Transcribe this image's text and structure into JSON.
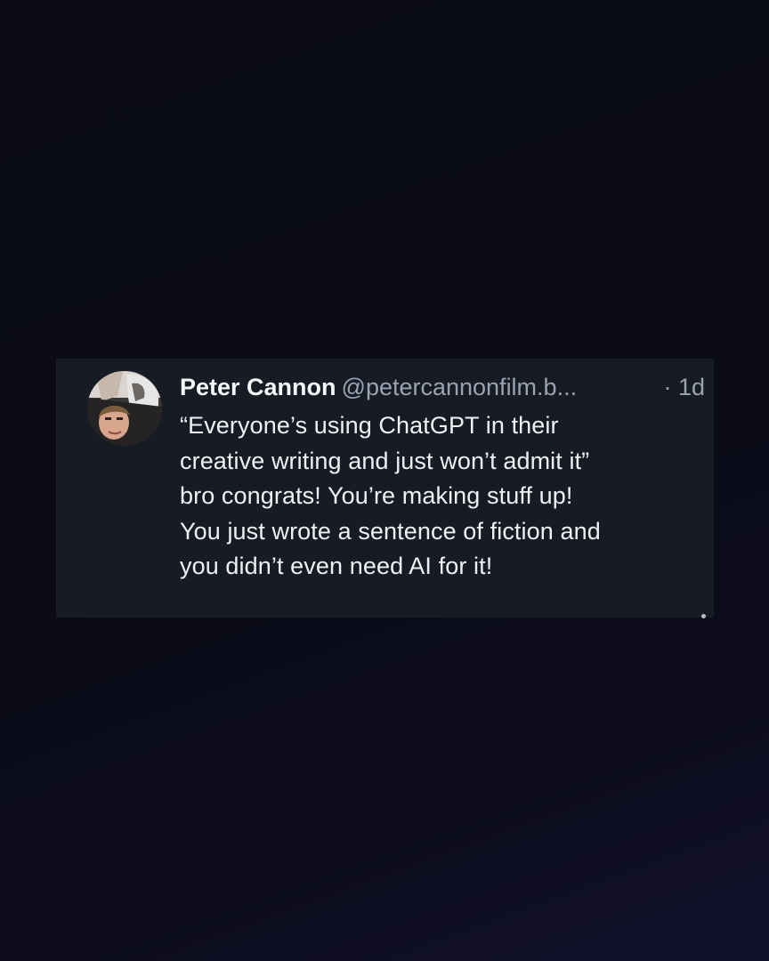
{
  "post": {
    "author_name": "Peter Cannon",
    "author_handle": "@petercannonfilm.b...",
    "timestamp": "· 1d",
    "avatar_icon": "profile-photo-avatar",
    "text_lines": [
      "“Everyone’s using ChatGPT in their",
      "creative writing and just won’t admit it”",
      "bro congrats! You’re making stuff up!",
      "You just wrote a sentence of fiction and",
      "you didn’t even need AI for it!"
    ]
  },
  "colors": {
    "background": "#0b0c14",
    "card": "#161b24",
    "text": "#eef0f3",
    "muted": "#9aa3b2"
  }
}
